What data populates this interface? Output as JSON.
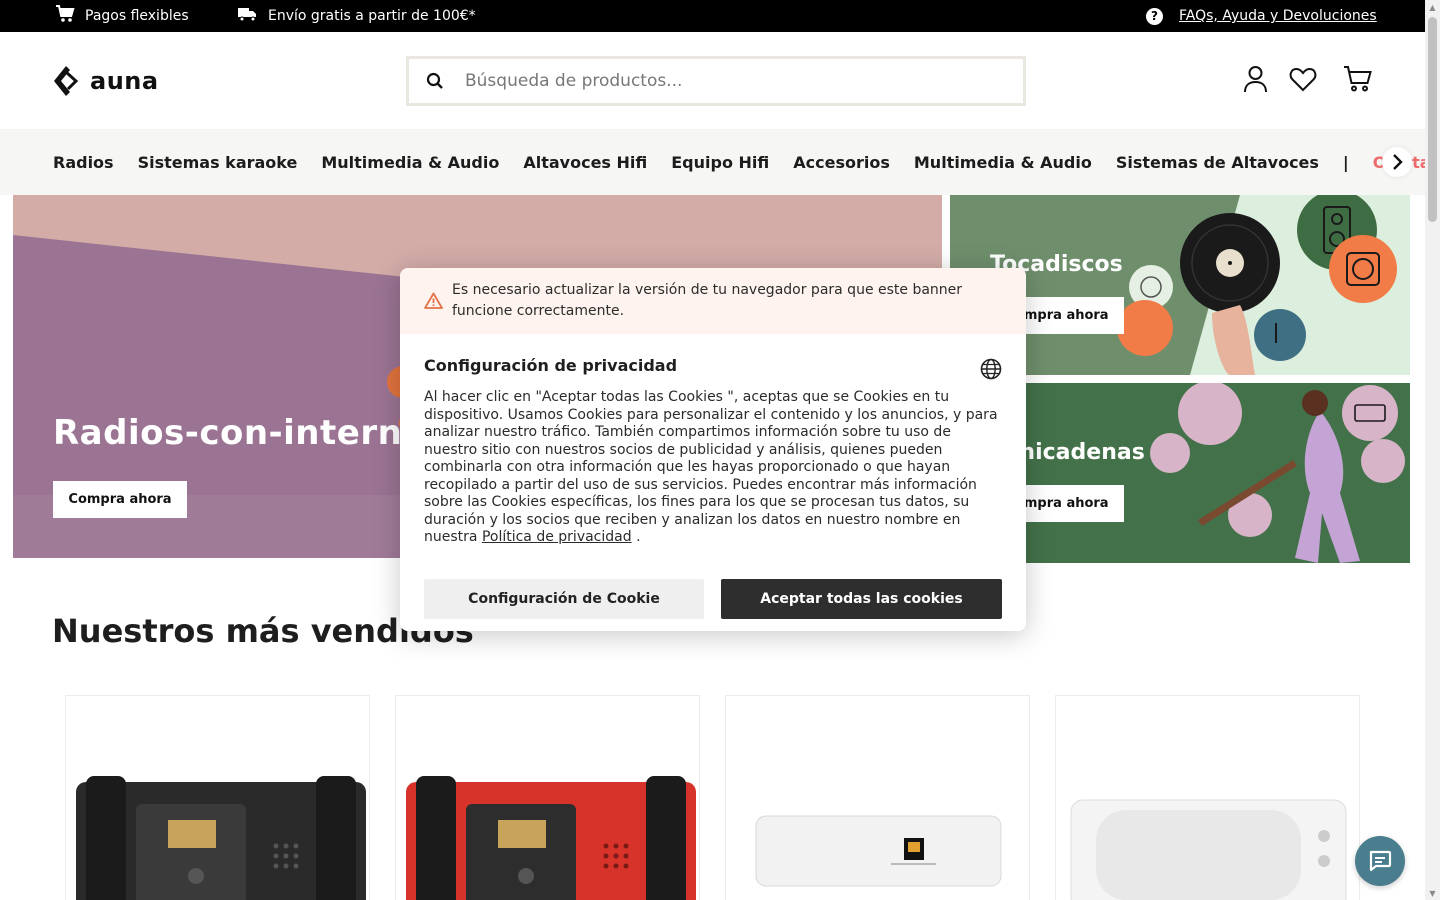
{
  "topbar": {
    "payments": "Pagos flexibles",
    "shipping": "Envío gratis a partir de 100€*",
    "help_link": "FAQs, Ayuda y Devoluciones"
  },
  "header": {
    "logo": "auna",
    "search_placeholder": "Búsqueda de productos..."
  },
  "nav": {
    "items": [
      "Radios",
      "Sistemas karaoke",
      "Multimedia & Audio",
      "Altavoces Hifi",
      "Equipo Hifi",
      "Accesorios",
      "Multimedia & Audio",
      "Sistemas de Altavoces"
    ],
    "separator": "|",
    "offers": "Ofertas"
  },
  "hero": {
    "main_title": "Radios-con-internet",
    "main_cta": "Compra ahora",
    "side_top_title": "Tocadiscos",
    "side_top_cta": "Compra ahora",
    "side_bottom_title": "Minicadenas",
    "side_bottom_cta": "Compra ahora"
  },
  "bestsellers": {
    "title": "Nuestros más vendidos"
  },
  "cookie_modal": {
    "warning": "Es necesario actualizar la versión de tu navegador para que este banner funcione correctamente.",
    "title": "Configuración de privacidad",
    "body": "Al hacer clic en \"Aceptar todas las Cookies \", aceptas que se Cookies en tu dispositivo. Usamos Cookies para personalizar el contenido y los anuncios, y para analizar nuestro tráfico. También compartimos información sobre tu uso de nuestro sitio con nuestros socios de publicidad y análisis, quienes pueden combinarla con otra información que les hayas proporcionado o que hayan recopilado a partir del uso de sus servicios. Puedes encontrar más información sobre las Cookies específicas, los fines para los que se procesan tus datos, su duración y los socios que reciben y analizan los datos en nuestro nombre en nuestra",
    "policy_link": "Política de privacidad",
    "body_end": ".",
    "settings_button": "Configuración de Cookie",
    "accept_button": "Aceptar todas las cookies"
  },
  "colors": {
    "accent_offer": "#ee6c6c",
    "chat_button": "#4a7e8e",
    "hero_pink": "#d3aca8",
    "hero_purple": "#9b7493",
    "side_green": "#43724a",
    "side_mint": "#dceedd"
  }
}
